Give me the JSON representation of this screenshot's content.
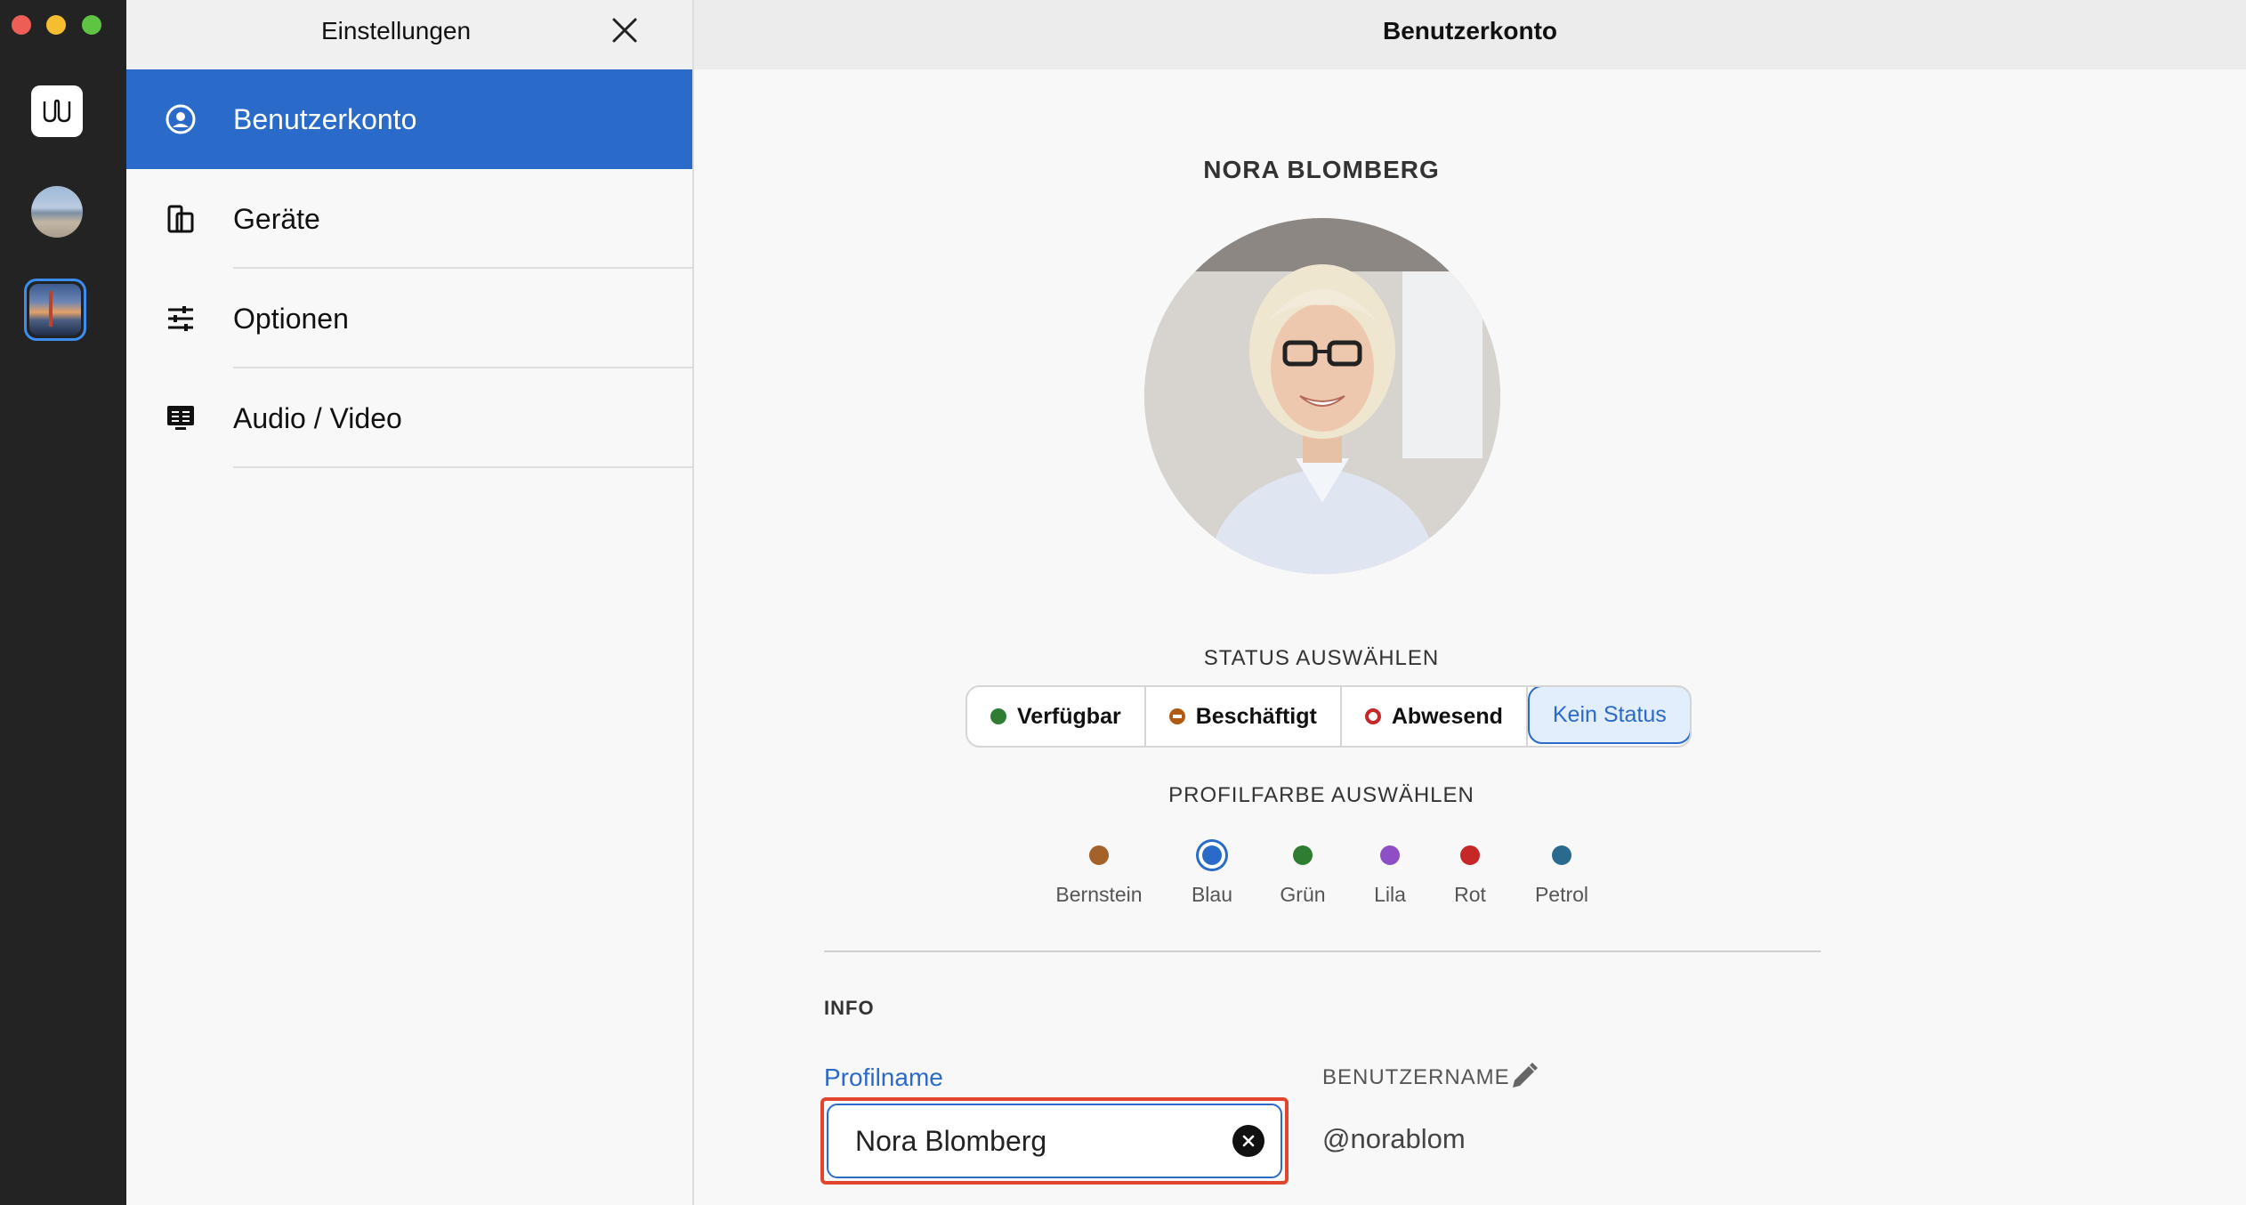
{
  "sidebar": {
    "title": "Einstellungen",
    "items": [
      {
        "label": "Benutzerkonto",
        "icon": "account-circle-icon",
        "active": true
      },
      {
        "label": "Geräte",
        "icon": "devices-icon",
        "active": false
      },
      {
        "label": "Optionen",
        "icon": "sliders-icon",
        "active": false
      },
      {
        "label": "Audio / Video",
        "icon": "monitor-icon",
        "active": false
      }
    ]
  },
  "main": {
    "title": "Benutzerkonto",
    "profile_name": "NORA BLOMBERG",
    "status_heading": "STATUS AUSWÄHLEN",
    "statuses": [
      {
        "label": "Verfügbar",
        "color": "#2e7d32"
      },
      {
        "label": "Beschäftigt",
        "color": "#b05a13"
      },
      {
        "label": "Abwesend",
        "color": "#c62828"
      },
      {
        "label": "Kein Status",
        "selected": true
      }
    ],
    "color_heading": "PROFILFARBE AUSWÄHLEN",
    "colors": [
      {
        "label": "Bernstein",
        "hex": "#a5612a"
      },
      {
        "label": "Blau",
        "hex": "#2a6ac8",
        "selected": true
      },
      {
        "label": "Grün",
        "hex": "#2e7d32"
      },
      {
        "label": "Lila",
        "hex": "#8e4ec6"
      },
      {
        "label": "Rot",
        "hex": "#c62828"
      },
      {
        "label": "Petrol",
        "hex": "#2a6a8e"
      }
    ],
    "info_heading": "INFO",
    "profile_field_label": "Profilname",
    "profile_field_value": "Nora Blomberg",
    "username_label": "BENUTZERNAME",
    "username_value": "@norablom"
  },
  "colors": {
    "accent": "#2a6ac8",
    "highlight_border": "#e2452d",
    "rail_bg": "#232323"
  }
}
